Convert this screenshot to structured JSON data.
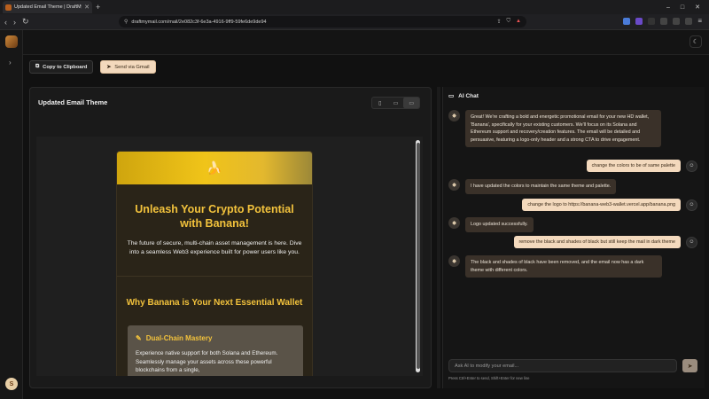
{
  "browser": {
    "tab_title": "Updated Email Theme | DraftMy",
    "url": "draftmymail.com/mail/2e082c3f-6e3a-4916-9ff9-59fe6de9de94",
    "new_tab_symbol": "+",
    "window_controls": [
      "–",
      "□",
      "✕"
    ]
  },
  "toolbar": {
    "copy_label": "Copy to Clipboard",
    "gmail_label": "Send via Gmail"
  },
  "rail": {
    "user_initial": "S"
  },
  "preview": {
    "title": "Updated Email Theme",
    "email": {
      "logo_glyph": "🍌",
      "hero_title": "Unleash Your Crypto Potential with Banana!",
      "hero_text": "The future of secure, multi-chain asset management is here. Dive into a seamless Web3 experience built for power users like you.",
      "section_title": "Why Banana is Your Next Essential Wallet",
      "feature_title": "Dual-Chain Mastery",
      "feature_text": "Experience native support for both Solana and Ethereum. Seamlessly manage your assets across these powerful blockchains from a single,"
    }
  },
  "chat": {
    "title": "AI Chat",
    "messages": [
      {
        "role": "bot",
        "text": "Great! We're crafting a bold and energetic promotional email for your new HD wallet, 'Banana', specifically for your existing customers. We'll focus on its Solana and Ethereum support and recovery/creation features. The email will be detailed and persuasive, featuring a logo-only header and a strong CTA to drive engagement."
      },
      {
        "role": "user",
        "text": "change the colors to be of same palette"
      },
      {
        "role": "bot",
        "text": "I have updated the colors to maintain the same theme and palette."
      },
      {
        "role": "user",
        "text": "change the logo to https://banana-web3-wallet.vercel.app/banana.png"
      },
      {
        "role": "bot",
        "text": "Logo updated successfully."
      },
      {
        "role": "user",
        "text": "remove the black and shades of black but still keep the mail in dark theme"
      },
      {
        "role": "bot",
        "text": "The black and shades of black have been removed, and the email now has a dark theme with different colors."
      }
    ],
    "input_placeholder": "Ask AI to modify your email...",
    "hint": "Press Ctrl+Enter to send, Shift+Enter for new line"
  }
}
